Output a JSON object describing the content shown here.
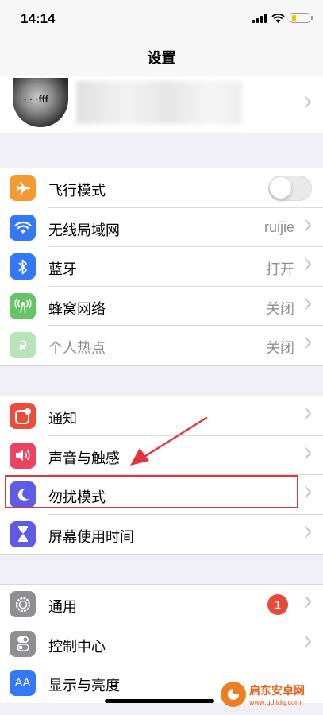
{
  "status_bar": {
    "time": "14:14"
  },
  "nav": {
    "title": "设置"
  },
  "profile": {
    "avatar_text": "·  ·  ·fff"
  },
  "group1": [
    {
      "name": "airplane-mode",
      "label": "飞行模式",
      "value": "",
      "icon": "airplane-icon",
      "color": "#f39a32",
      "toggle_on": false
    },
    {
      "name": "wlan",
      "label": "无线局域网",
      "value": "ruijie",
      "icon": "wifi-icon",
      "color": "#3478f6"
    },
    {
      "name": "bluetooth",
      "label": "蓝牙",
      "value": "打开",
      "icon": "bluetooth-icon",
      "color": "#3478f6"
    },
    {
      "name": "cellular",
      "label": "蜂窝网络",
      "value": "关闭",
      "icon": "cellular-icon",
      "color": "#65c466"
    },
    {
      "name": "hotspot",
      "label": "个人热点",
      "value": "关闭",
      "icon": "hotspot-icon",
      "color": "#65c466",
      "disabled": true
    }
  ],
  "group2": [
    {
      "name": "notifications",
      "label": "通知",
      "icon": "notifications-icon",
      "color": "#eb4d3d"
    },
    {
      "name": "sounds",
      "label": "声音与触感",
      "icon": "speaker-icon",
      "color": "#eb4462"
    },
    {
      "name": "do-not-disturb",
      "label": "勿扰模式",
      "icon": "moon-icon",
      "color": "#5e5ce6"
    },
    {
      "name": "screen-time",
      "label": "屏幕使用时间",
      "icon": "hourglass-icon",
      "color": "#5e5ce6"
    }
  ],
  "group3": [
    {
      "name": "general",
      "label": "通用",
      "icon": "gear-icon",
      "color": "#8e8e93",
      "badge": "1"
    },
    {
      "name": "control-center",
      "label": "控制中心",
      "icon": "toggles-icon",
      "color": "#8e8e93"
    },
    {
      "name": "display",
      "label": "显示与亮度",
      "icon": "text-size-icon",
      "color": "#3478f6",
      "icon_text": "AA"
    }
  ],
  "watermark": {
    "title": "启东安卓网",
    "url": "www.qdltdq.com"
  },
  "colors": {
    "highlight": "#e0363b",
    "background": "#efeff4"
  }
}
